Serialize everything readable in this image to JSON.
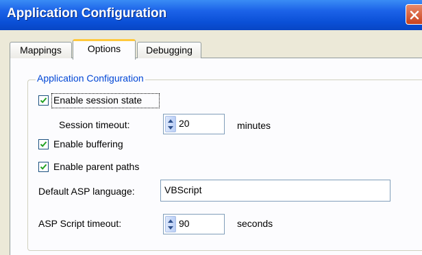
{
  "window": {
    "title": "Application Configuration",
    "close_icon": "close-icon"
  },
  "tabs": [
    {
      "label": "Mappings",
      "selected": false
    },
    {
      "label": "Options",
      "selected": true
    },
    {
      "label": "Debugging",
      "selected": false
    }
  ],
  "group": {
    "legend": "Application Configuration"
  },
  "options": {
    "session_state": {
      "label": "Enable session state",
      "checked": true
    },
    "session_timeout": {
      "label": "Session timeout:",
      "value": "20",
      "unit": "minutes"
    },
    "buffering": {
      "label": "Enable buffering",
      "checked": true
    },
    "parent_paths": {
      "label": "Enable parent paths",
      "checked": true
    },
    "asp_language": {
      "label": "Default ASP language:",
      "value": "VBScript"
    },
    "script_timeout": {
      "label": "ASP Script timeout:",
      "value": "90",
      "unit": "seconds"
    }
  },
  "colors": {
    "titlebar": "#0a4fd6",
    "legend": "#0046d5",
    "active_tab_accent": "#ffc83c"
  }
}
